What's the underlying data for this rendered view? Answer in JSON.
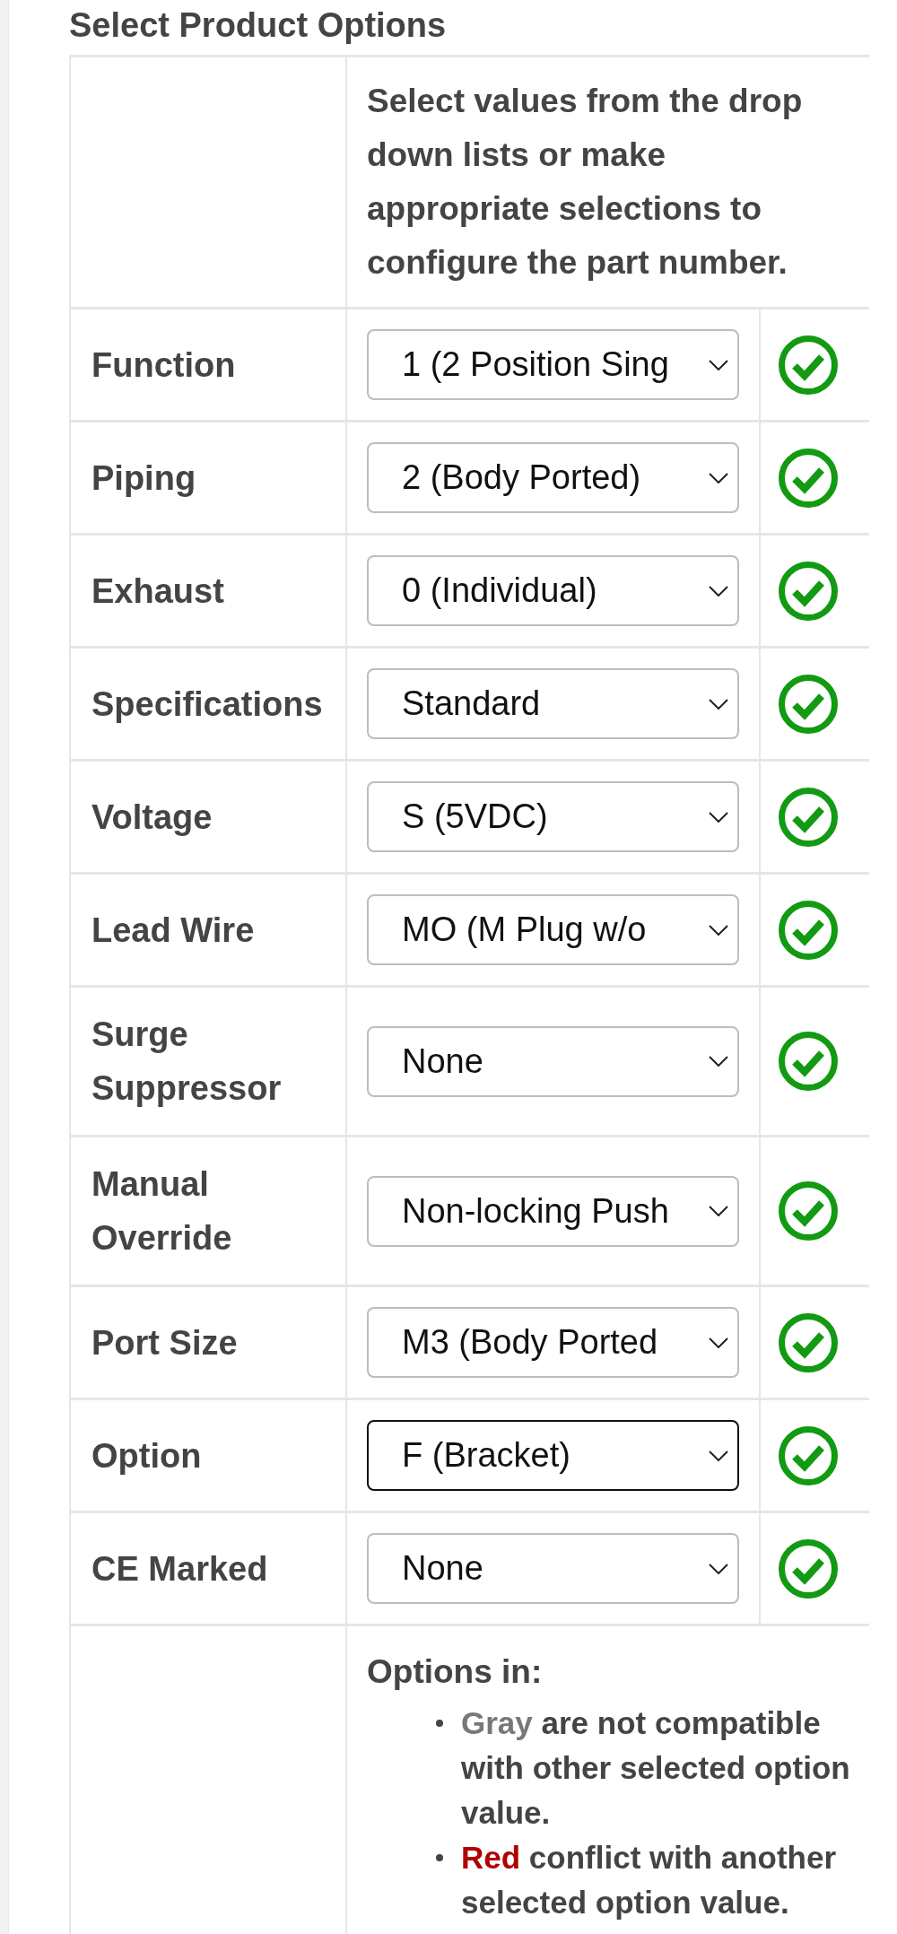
{
  "page": {
    "title": "Select Product Options"
  },
  "config_table": {
    "instructions": "Select values from the drop down lists or make appropriate selections to configure the part number.",
    "options": [
      {
        "label": "Function",
        "value": "1 (2 Position Sing",
        "focused": false,
        "valid": true
      },
      {
        "label": "Piping",
        "value": "2 (Body Ported)",
        "focused": false,
        "valid": true
      },
      {
        "label": "Exhaust",
        "value": "0 (Individual)",
        "focused": false,
        "valid": true
      },
      {
        "label": "Specifications",
        "value": "Standard",
        "focused": false,
        "valid": true
      },
      {
        "label": "Voltage",
        "value": "S (5VDC)",
        "focused": false,
        "valid": true
      },
      {
        "label": "Lead Wire",
        "value": "MO (M Plug w/o",
        "focused": false,
        "valid": true
      },
      {
        "label": "Surge Suppressor",
        "value": "None",
        "focused": false,
        "valid": true
      },
      {
        "label": "Manual Override",
        "value": "Non-locking Push",
        "focused": false,
        "valid": true
      },
      {
        "label": "Port Size",
        "value": "M3 (Body Ported",
        "focused": false,
        "valid": true
      },
      {
        "label": "Option",
        "value": "F (Bracket)",
        "focused": true,
        "valid": true
      },
      {
        "label": "CE Marked",
        "value": "None",
        "focused": false,
        "valid": true
      }
    ],
    "legend": {
      "title": "Options in:",
      "items": [
        {
          "term": "Gray",
          "color": "#787878",
          "text": "are not compatible with other selected option value."
        },
        {
          "term": "Red",
          "color": "#b00000",
          "text": "conflict with another selected option value."
        }
      ]
    }
  }
}
